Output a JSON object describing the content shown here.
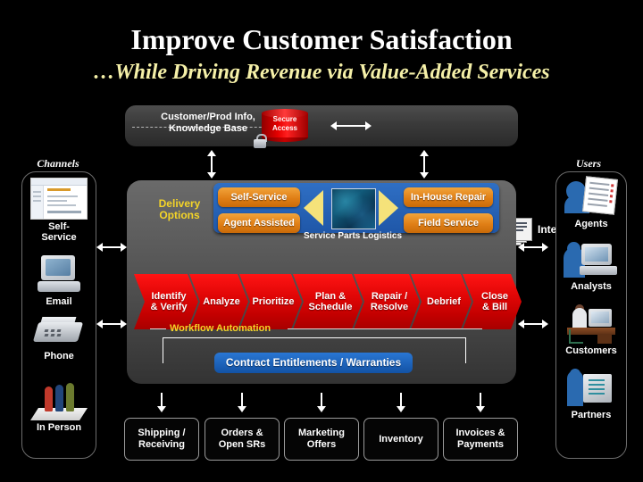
{
  "slide": {
    "title": "Improve Customer Satisfaction",
    "subtitle": "…While Driving Revenue via Value-Added Services"
  },
  "top_bar": {
    "info_label": "Customer/Prod Info,\nKnowledge Base",
    "info_line1": "Customer/Prod Info,",
    "info_line2": "Knowledge Base",
    "secure_access": "Secure Access",
    "secure_line1": "Secure",
    "secure_line2": "Access",
    "intelligence": "Intelligence"
  },
  "channels": {
    "header": "Channels",
    "items": [
      {
        "label": "Self-\nService",
        "line1": "Self-",
        "line2": "Service",
        "icon": "web-page-icon"
      },
      {
        "label": "Email",
        "line1": "Email",
        "line2": "",
        "icon": "desktop-computer-icon"
      },
      {
        "label": "Phone",
        "line1": "Phone",
        "line2": "",
        "icon": "fax-phone-icon"
      },
      {
        "label": "In Person",
        "line1": "In Person",
        "line2": "",
        "icon": "people-icon"
      }
    ]
  },
  "users": {
    "header": "Users",
    "items": [
      {
        "label": "Agents",
        "icon": "agent-document-icon"
      },
      {
        "label": "Analysts",
        "icon": "analyst-computer-icon"
      },
      {
        "label": "Customers",
        "icon": "customer-desk-icon"
      },
      {
        "label": "Partners",
        "icon": "partner-server-icon"
      }
    ]
  },
  "delivery": {
    "label": "Delivery Options",
    "label_line1": "Delivery",
    "label_line2": "Options",
    "left_options": [
      "Self-Service",
      "Agent Assisted"
    ],
    "right_options": [
      "In-House Repair",
      "Field Service"
    ],
    "center_caption": "Service Parts Logistics"
  },
  "workflow": {
    "automation_label": "Workflow Automation",
    "steps": [
      {
        "line1": "Identify",
        "line2": "& Verify"
      },
      {
        "line1": "Analyze",
        "line2": ""
      },
      {
        "line1": "Prioritize",
        "line2": ""
      },
      {
        "line1": "Plan &",
        "line2": "Schedule"
      },
      {
        "line1": "Repair /",
        "line2": "Resolve"
      },
      {
        "line1": "Debrief",
        "line2": ""
      },
      {
        "line1": "Close",
        "line2": "& Bill"
      }
    ]
  },
  "contract": {
    "label": "Contract Entitlements / Warranties"
  },
  "bottom_boxes": [
    {
      "line1": "Shipping /",
      "line2": "Receiving"
    },
    {
      "line1": "Orders &",
      "line2": "Open SRs"
    },
    {
      "line1": "Marketing",
      "line2": "Offers"
    },
    {
      "line1": "Inventory",
      "line2": ""
    },
    {
      "line1": "Invoices &",
      "line2": "Payments"
    }
  ],
  "colors": {
    "background": "#000000",
    "title": "#ffffff",
    "subtitle": "#f5f0a8",
    "panel_gray": "#5a5a5a",
    "accent_blue": "#1f57a8",
    "accent_orange": "#e07f16",
    "accent_red": "#e00606",
    "accent_yellow": "#f4d428"
  }
}
